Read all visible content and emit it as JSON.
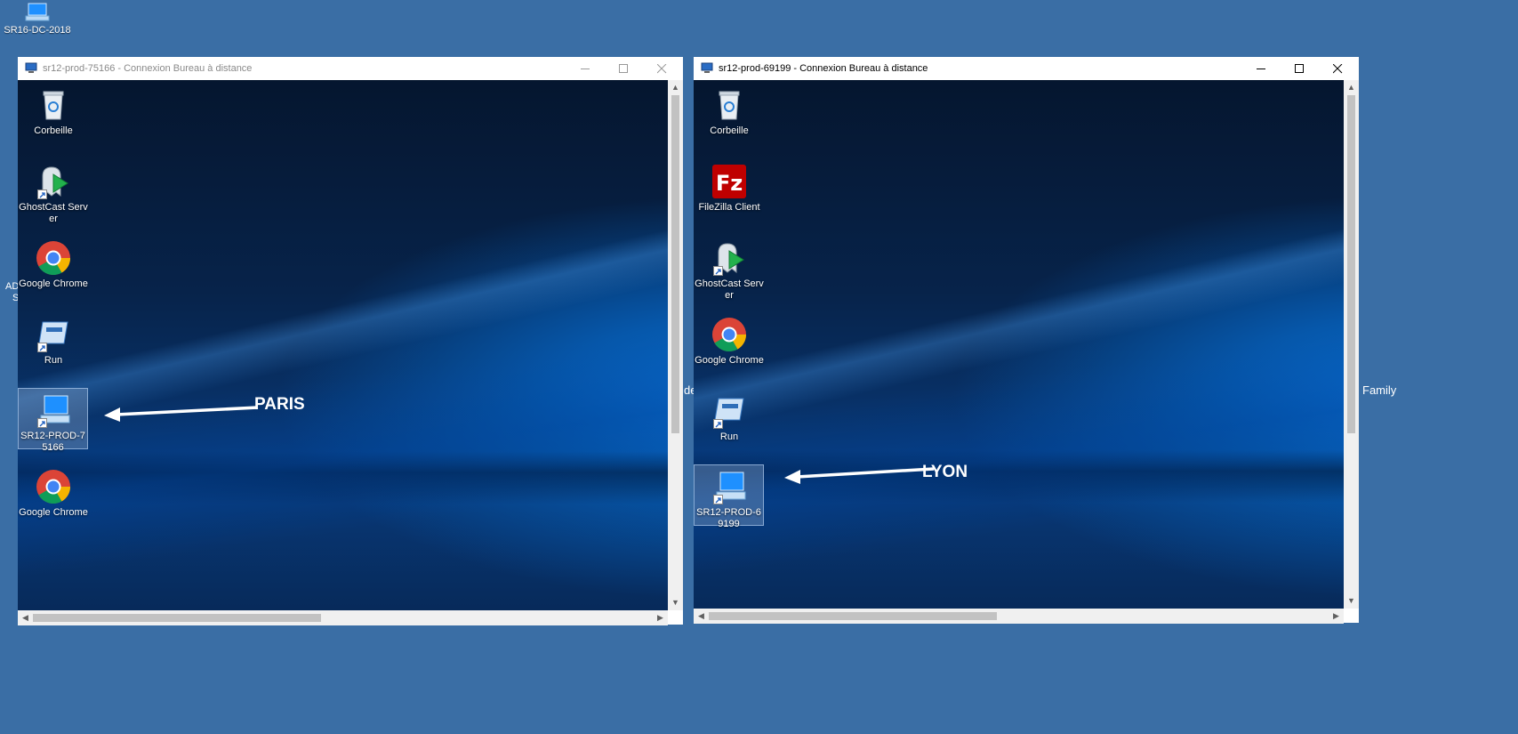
{
  "host_desktop": {
    "icon": {
      "label": "SR16-DC-2018",
      "icon": "computer-icon"
    },
    "fragments": [
      "AD",
      "S",
      "de",
      "Family"
    ]
  },
  "windows": [
    {
      "title": "sr12-prod-75166 - Connexion Bureau à distance",
      "state": "inactive",
      "controls": {
        "minimize": "minimize-icon",
        "maximize": "maximize-icon",
        "close": "close-icon"
      },
      "icons": [
        {
          "label": "Corbeille",
          "icon": "recycle-bin-icon"
        },
        {
          "label": "GhostCast Server",
          "icon": "ghostcast-icon"
        },
        {
          "label": "Google Chrome",
          "icon": "chrome-icon"
        },
        {
          "label": "Run",
          "icon": "run-icon"
        },
        {
          "label": "SR12-PROD-75166",
          "icon": "computer-icon",
          "selected": true
        },
        {
          "label": "Google Chrome",
          "icon": "chrome-icon"
        }
      ],
      "callout": "PARIS"
    },
    {
      "title": "sr12-prod-69199 - Connexion Bureau à distance",
      "state": "active",
      "controls": {
        "minimize": "minimize-icon",
        "maximize": "maximize-icon",
        "close": "close-icon"
      },
      "icons": [
        {
          "label": "Corbeille",
          "icon": "recycle-bin-icon"
        },
        {
          "label": "FileZilla Client",
          "icon": "filezilla-icon"
        },
        {
          "label": "GhostCast Server",
          "icon": "ghostcast-icon"
        },
        {
          "label": "Google Chrome",
          "icon": "chrome-icon"
        },
        {
          "label": "Run",
          "icon": "run-icon"
        },
        {
          "label": "SR12-PROD-69199",
          "icon": "computer-icon",
          "selected": true
        }
      ],
      "callout": "LYON"
    }
  ],
  "colors": {
    "host_background": "#3a6ea5",
    "titlebar": "#ffffff",
    "scrollbar_track": "#f0f0f0",
    "scrollbar_thumb": "#c2c2c2"
  }
}
